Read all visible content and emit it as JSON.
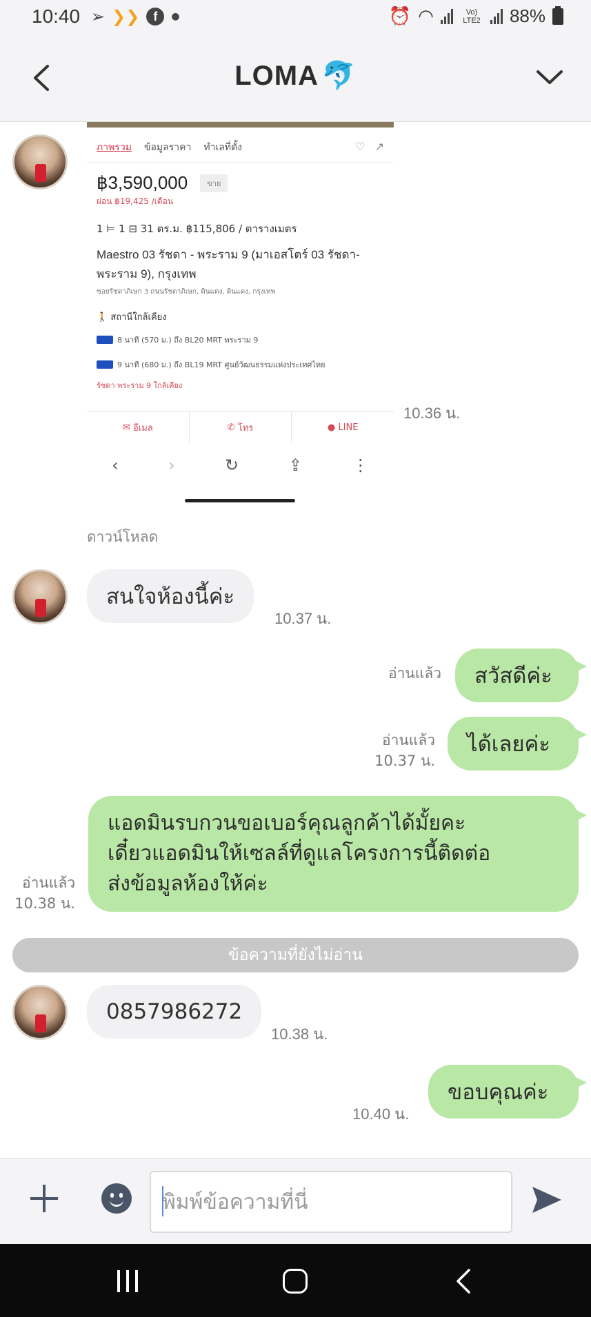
{
  "status_bar": {
    "time": "10:40",
    "battery": "88%",
    "network": "Vo) LTE2",
    "icons": [
      "navigation-icon",
      "orange-app-icon",
      "facebook-icon",
      "dot-icon",
      "alarm-icon",
      "wifi-icon",
      "signal-icon",
      "signal-icon",
      "battery-icon"
    ]
  },
  "header": {
    "title": "LOMA",
    "title_icon": "dolphin-icon",
    "back_icon": "back-chevron-icon",
    "menu_icon": "chevron-down-icon"
  },
  "shared_image": {
    "tabs": [
      "ภาพรวม",
      "ข้อมูลราคา",
      "ทำเลที่ตั้ง"
    ],
    "price": "฿3,590,000",
    "price_tag": "ขาย",
    "monthly": "ผ่อน ฿19,425 /เดือน",
    "specs": "1 ⊨   1 ⊟   31 ตร.ม.   ฿115,806 / ตารางเมตร",
    "name": "Maestro 03 รัชดา - พระราม 9 (มาเอสโตร์ 03 รัชดา-พระราม 9), กรุงเทพ",
    "address": "ซอยรัชดาภิเษก 3 ถนนรัชดาภิเษก, ดินแดง, ดินแดง, กรุงเทพ",
    "nearby_title": "สถานีใกล้เคียง",
    "stations": [
      "8 นาที (570 ม.) ถึง BL20 MRT พระราม 9",
      "9 นาที (680 ม.) ถึง BL19 MRT ศูนย์วัฒนธรรมแห่งประเทศไทย"
    ],
    "more": "รัชดา พระราม 9 ใกล้เคียง",
    "actions": [
      "อีเมล",
      "โทร",
      "LINE"
    ],
    "time": "10.36 น."
  },
  "download_label": "ดาวน์โหลด",
  "messages": [
    {
      "side": "in",
      "text": "สนใจห้องนี้ค่ะ",
      "time": "10.37 น."
    },
    {
      "side": "out",
      "text": "สวัสดีค่ะ",
      "read": "อ่านแล้ว"
    },
    {
      "side": "out",
      "text": "ได้เลยค่ะ",
      "read": "อ่านแล้ว",
      "time": "10.37 น."
    },
    {
      "side": "out",
      "lines": [
        "แอดมินรบกวนขอเบอร์คุณลูกค้าได้มั้ยคะ",
        "เดี๋ยวแอดมินให้เซลล์ที่ดูแลโครงการนี้ติดต่อ",
        "ส่งข้อมูลห้องให้ค่ะ"
      ],
      "read": "อ่านแล้ว",
      "time": "10.38 น."
    },
    {
      "side": "in",
      "text": "0857986272",
      "time": "10.38 น."
    },
    {
      "side": "out",
      "text": "ขอบคุณค่ะ",
      "time": "10.40 น."
    }
  ],
  "unread_divider": "ข้อความที่ยังไม่อ่าน",
  "input": {
    "placeholder": "พิมพ์ข้อความที่นี่",
    "plus_icon": "plus-icon",
    "emoji_icon": "emoji-icon",
    "send_icon": "send-icon"
  },
  "nav": {
    "icons": [
      "recents-icon",
      "home-icon",
      "back-icon"
    ]
  }
}
